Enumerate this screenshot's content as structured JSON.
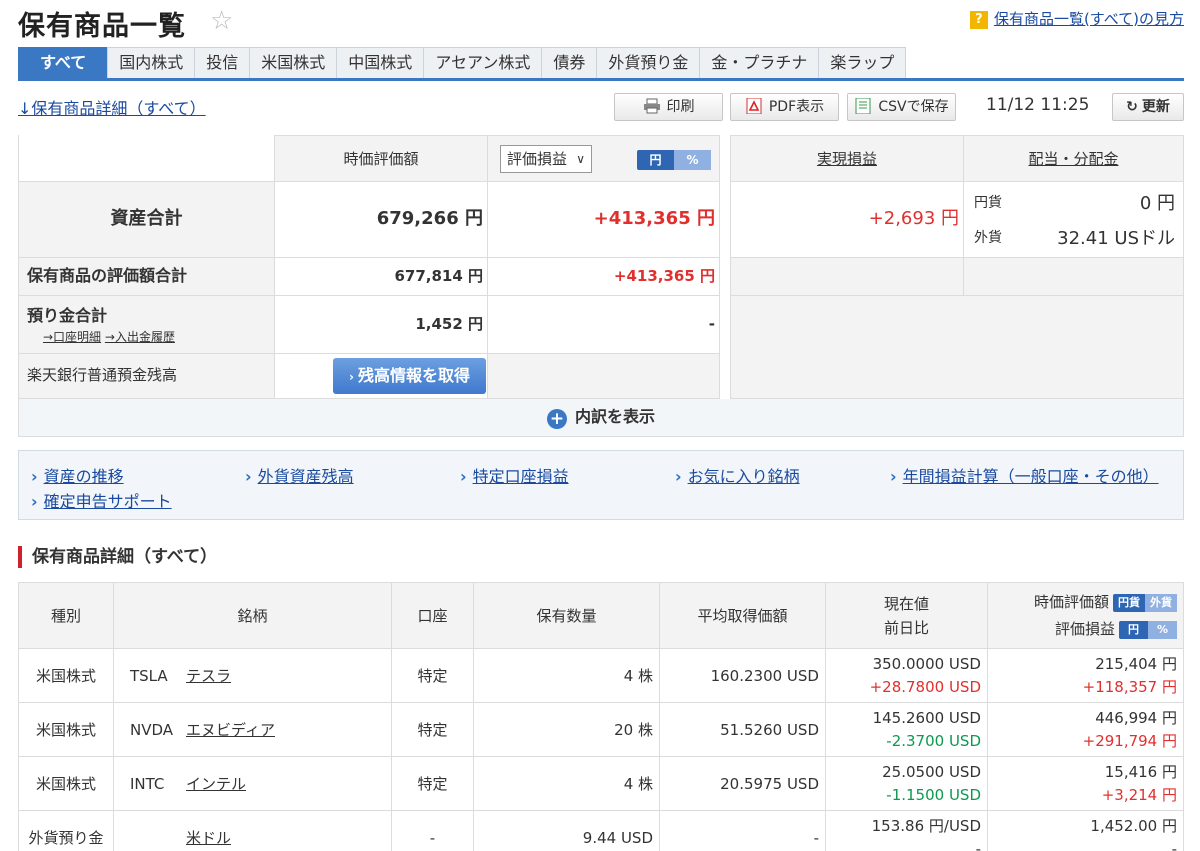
{
  "header": {
    "title": "保有商品一覧",
    "help_link": "保有商品一覧(すべて)の見方"
  },
  "tabs": [
    "すべて",
    "国内株式",
    "投信",
    "米国株式",
    "中国株式",
    "アセアン株式",
    "債券",
    "外貨預り金",
    "金・プラチナ",
    "楽ラップ"
  ],
  "toolbar": {
    "detail_link": "↓保有商品詳細（すべて）",
    "print": "印刷",
    "pdf": "PDF表示",
    "csv": "CSVで保存",
    "timestamp": "11/12 11:25",
    "refresh": "更新"
  },
  "summary": {
    "col_value": "時価評価額",
    "select_value": "評価損益",
    "toggle": [
      "円",
      "%"
    ],
    "col_realized": "実現損益",
    "col_dividend": "配当・分配金",
    "total_label": "資産合計",
    "total_value": "679,266 円",
    "total_pl": "+413,365 円",
    "realized": "+2,693 円",
    "div_jpy_label": "円貨",
    "div_jpy_value": "0 円",
    "div_fx_label": "外貨",
    "div_fx_value": "32.41 USドル",
    "holdings_label": "保有商品の評価額合計",
    "holdings_value": "677,814 円",
    "holdings_pl": "+413,365 円",
    "deposit_label": "預り金合計",
    "deposit_link1": "→口座明細",
    "deposit_link2": "→入出金履歴",
    "deposit_value": "1,452 円",
    "deposit_pl": "-",
    "bank_label": "楽天銀行普通預金残高",
    "bank_button": "残高情報を取得",
    "expand": "内訳を表示"
  },
  "quick_links": [
    "資産の推移",
    "外貨資産残高",
    "特定口座損益",
    "お気に入り銘柄",
    "年間損益計算（一般口座・その他）",
    "確定申告サポート"
  ],
  "section_title": "保有商品詳細（すべて）",
  "holdings": {
    "headers": {
      "type": "種別",
      "name": "銘柄",
      "account": "口座",
      "qty": "保有数量",
      "avg": "平均取得価額",
      "price1": "現在値",
      "price2": "前日比",
      "val1": "時価評価額",
      "val2": "評価損益",
      "pill1": [
        "円貨",
        "外貨"
      ],
      "pill2": [
        "円",
        "%"
      ]
    },
    "rows": [
      {
        "type": "米国株式",
        "ticker": "TSLA",
        "name": "テスラ",
        "account": "特定",
        "qty": "4 株",
        "avg": "160.2300 USD",
        "price": "350.0000 USD",
        "change": "+28.7800 USD",
        "value": "215,404 円",
        "pl": "+118,357 円",
        "change_color": "#e0302e"
      },
      {
        "type": "米国株式",
        "ticker": "NVDA",
        "name": "エヌビディア",
        "account": "特定",
        "qty": "20 株",
        "avg": "51.5260 USD",
        "price": "145.2600 USD",
        "change": "-2.3700 USD",
        "value": "446,994 円",
        "pl": "+291,794 円",
        "change_color": "#0a9a4e"
      },
      {
        "type": "米国株式",
        "ticker": "INTC",
        "name": "インテル",
        "account": "特定",
        "qty": "4 株",
        "avg": "20.5975 USD",
        "price": "25.0500 USD",
        "change": "-1.1500 USD",
        "value": "15,416 円",
        "pl": "+3,214 円",
        "change_color": "#0a9a4e"
      },
      {
        "type": "外貨預り金",
        "ticker": "",
        "name": "米ドル",
        "account": "-",
        "qty": "9.44 USD",
        "avg": "-",
        "price": "153.86 円/USD",
        "change": "-",
        "value": "1,452.00 円",
        "pl": "-",
        "change_color": "#333333"
      }
    ]
  }
}
